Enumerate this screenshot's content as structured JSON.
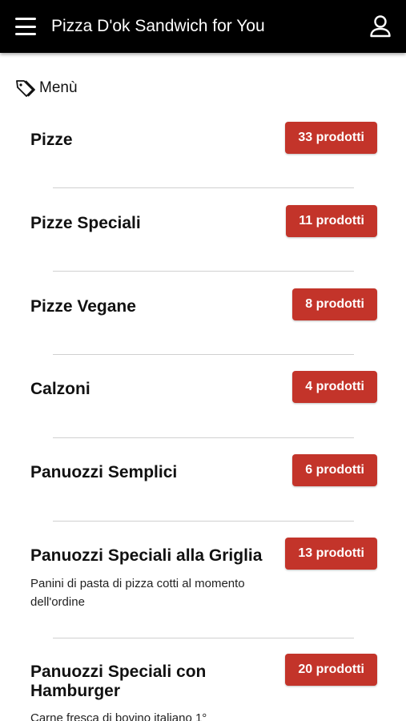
{
  "header": {
    "title": "Pizza D'ok Sandwich for You"
  },
  "section": {
    "label": "Menù"
  },
  "categories": [
    {
      "name": "Pizze",
      "count": "33 prodotti",
      "description": ""
    },
    {
      "name": "Pizze Speciali",
      "count": "11 prodotti",
      "description": ""
    },
    {
      "name": "Pizze Vegane",
      "count": "8 prodotti",
      "description": ""
    },
    {
      "name": "Calzoni",
      "count": "4 prodotti",
      "description": ""
    },
    {
      "name": "Panuozzi Semplici",
      "count": "6 prodotti",
      "description": ""
    },
    {
      "name": "Panuozzi Speciali alla Griglia",
      "count": "13 prodotti",
      "description": "Panini di pasta di pizza cotti al momento dell'ordine"
    },
    {
      "name": "Panuozzi Speciali con Hamburger",
      "count": "20 prodotti",
      "description": "Carne fresca di bovino italiano 1°"
    }
  ],
  "colors": {
    "header_bg": "#000000",
    "badge_bg": "#c3342a",
    "divider": "#d0d0d0"
  },
  "icons": {
    "menu": "hamburger-menu-icon",
    "user": "user-icon",
    "tag": "tag-icon"
  }
}
